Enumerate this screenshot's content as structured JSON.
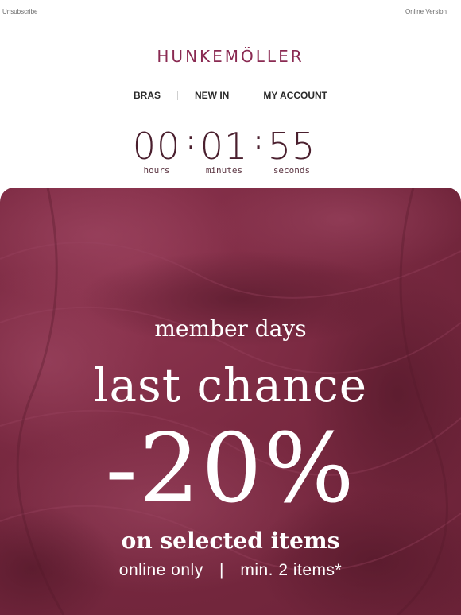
{
  "topbar": {
    "unsubscribe": "Unsubscribe",
    "online_version": "Online Version"
  },
  "brand": {
    "name": "HUNKEMÖLLER",
    "color": "#8a2a52"
  },
  "nav": {
    "items": [
      "BRAS",
      "NEW IN",
      "MY ACCOUNT"
    ]
  },
  "countdown": {
    "hours": "00",
    "minutes": "01",
    "seconds": "55",
    "hours_label": "hours",
    "minutes_label": "minutes",
    "seconds_label": "seconds"
  },
  "hero": {
    "background_color": "#7b2a42",
    "background_description": "burgundy lace texture",
    "member_days": "member days",
    "last_chance": "last chance",
    "discount": "-20%",
    "selected_items": "on selected items",
    "online_only": "online only",
    "separator": "|",
    "min_items": "min. 2 items*"
  }
}
